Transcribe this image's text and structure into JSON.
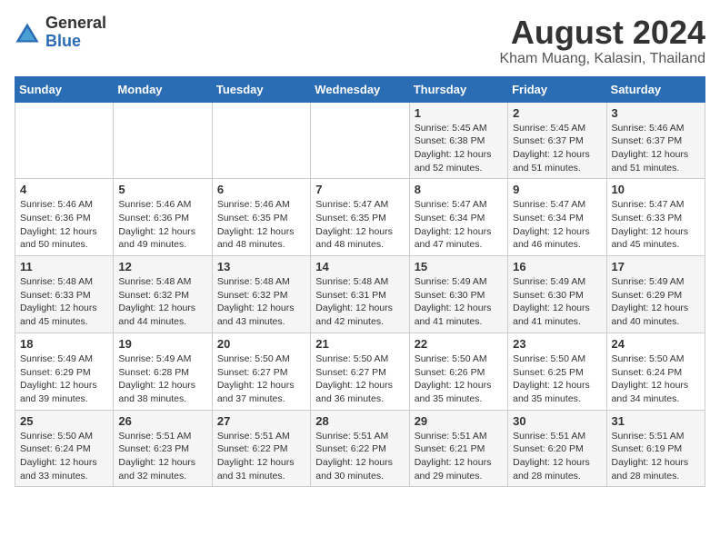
{
  "header": {
    "logo_general": "General",
    "logo_blue": "Blue",
    "main_title": "August 2024",
    "sub_title": "Kham Muang, Kalasin, Thailand"
  },
  "days_of_week": [
    "Sunday",
    "Monday",
    "Tuesday",
    "Wednesday",
    "Thursday",
    "Friday",
    "Saturday"
  ],
  "weeks": [
    [
      {
        "day": "",
        "info": ""
      },
      {
        "day": "",
        "info": ""
      },
      {
        "day": "",
        "info": ""
      },
      {
        "day": "",
        "info": ""
      },
      {
        "day": "1",
        "info": "Sunrise: 5:45 AM\nSunset: 6:38 PM\nDaylight: 12 hours\nand 52 minutes."
      },
      {
        "day": "2",
        "info": "Sunrise: 5:45 AM\nSunset: 6:37 PM\nDaylight: 12 hours\nand 51 minutes."
      },
      {
        "day": "3",
        "info": "Sunrise: 5:46 AM\nSunset: 6:37 PM\nDaylight: 12 hours\nand 51 minutes."
      }
    ],
    [
      {
        "day": "4",
        "info": "Sunrise: 5:46 AM\nSunset: 6:36 PM\nDaylight: 12 hours\nand 50 minutes."
      },
      {
        "day": "5",
        "info": "Sunrise: 5:46 AM\nSunset: 6:36 PM\nDaylight: 12 hours\nand 49 minutes."
      },
      {
        "day": "6",
        "info": "Sunrise: 5:46 AM\nSunset: 6:35 PM\nDaylight: 12 hours\nand 48 minutes."
      },
      {
        "day": "7",
        "info": "Sunrise: 5:47 AM\nSunset: 6:35 PM\nDaylight: 12 hours\nand 48 minutes."
      },
      {
        "day": "8",
        "info": "Sunrise: 5:47 AM\nSunset: 6:34 PM\nDaylight: 12 hours\nand 47 minutes."
      },
      {
        "day": "9",
        "info": "Sunrise: 5:47 AM\nSunset: 6:34 PM\nDaylight: 12 hours\nand 46 minutes."
      },
      {
        "day": "10",
        "info": "Sunrise: 5:47 AM\nSunset: 6:33 PM\nDaylight: 12 hours\nand 45 minutes."
      }
    ],
    [
      {
        "day": "11",
        "info": "Sunrise: 5:48 AM\nSunset: 6:33 PM\nDaylight: 12 hours\nand 45 minutes."
      },
      {
        "day": "12",
        "info": "Sunrise: 5:48 AM\nSunset: 6:32 PM\nDaylight: 12 hours\nand 44 minutes."
      },
      {
        "day": "13",
        "info": "Sunrise: 5:48 AM\nSunset: 6:32 PM\nDaylight: 12 hours\nand 43 minutes."
      },
      {
        "day": "14",
        "info": "Sunrise: 5:48 AM\nSunset: 6:31 PM\nDaylight: 12 hours\nand 42 minutes."
      },
      {
        "day": "15",
        "info": "Sunrise: 5:49 AM\nSunset: 6:30 PM\nDaylight: 12 hours\nand 41 minutes."
      },
      {
        "day": "16",
        "info": "Sunrise: 5:49 AM\nSunset: 6:30 PM\nDaylight: 12 hours\nand 41 minutes."
      },
      {
        "day": "17",
        "info": "Sunrise: 5:49 AM\nSunset: 6:29 PM\nDaylight: 12 hours\nand 40 minutes."
      }
    ],
    [
      {
        "day": "18",
        "info": "Sunrise: 5:49 AM\nSunset: 6:29 PM\nDaylight: 12 hours\nand 39 minutes."
      },
      {
        "day": "19",
        "info": "Sunrise: 5:49 AM\nSunset: 6:28 PM\nDaylight: 12 hours\nand 38 minutes."
      },
      {
        "day": "20",
        "info": "Sunrise: 5:50 AM\nSunset: 6:27 PM\nDaylight: 12 hours\nand 37 minutes."
      },
      {
        "day": "21",
        "info": "Sunrise: 5:50 AM\nSunset: 6:27 PM\nDaylight: 12 hours\nand 36 minutes."
      },
      {
        "day": "22",
        "info": "Sunrise: 5:50 AM\nSunset: 6:26 PM\nDaylight: 12 hours\nand 35 minutes."
      },
      {
        "day": "23",
        "info": "Sunrise: 5:50 AM\nSunset: 6:25 PM\nDaylight: 12 hours\nand 35 minutes."
      },
      {
        "day": "24",
        "info": "Sunrise: 5:50 AM\nSunset: 6:24 PM\nDaylight: 12 hours\nand 34 minutes."
      }
    ],
    [
      {
        "day": "25",
        "info": "Sunrise: 5:50 AM\nSunset: 6:24 PM\nDaylight: 12 hours\nand 33 minutes."
      },
      {
        "day": "26",
        "info": "Sunrise: 5:51 AM\nSunset: 6:23 PM\nDaylight: 12 hours\nand 32 minutes."
      },
      {
        "day": "27",
        "info": "Sunrise: 5:51 AM\nSunset: 6:22 PM\nDaylight: 12 hours\nand 31 minutes."
      },
      {
        "day": "28",
        "info": "Sunrise: 5:51 AM\nSunset: 6:22 PM\nDaylight: 12 hours\nand 30 minutes."
      },
      {
        "day": "29",
        "info": "Sunrise: 5:51 AM\nSunset: 6:21 PM\nDaylight: 12 hours\nand 29 minutes."
      },
      {
        "day": "30",
        "info": "Sunrise: 5:51 AM\nSunset: 6:20 PM\nDaylight: 12 hours\nand 28 minutes."
      },
      {
        "day": "31",
        "info": "Sunrise: 5:51 AM\nSunset: 6:19 PM\nDaylight: 12 hours\nand 28 minutes."
      }
    ]
  ]
}
